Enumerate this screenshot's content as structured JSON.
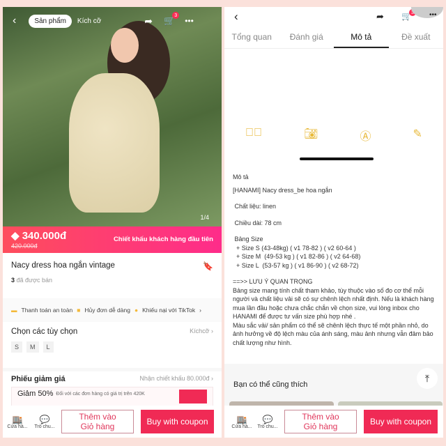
{
  "left": {
    "nav": {
      "pill": "Sản phẩm",
      "tab2": "Kích cỡ",
      "cart_count": "3"
    },
    "image_counter": "1/4",
    "price": {
      "current": "340.000đ",
      "original": "420.000đ",
      "promo": "Chiết khấu khách hàng đầu tiên"
    },
    "product": {
      "title": "Nacy dress hoa ngắn vintage",
      "sold_count": "3",
      "sold_label": "đã được bán"
    },
    "guarantees": [
      "Thanh toán an toàn",
      "Hủy đơn dễ dàng",
      "Khiếu nại với TikTok"
    ],
    "options": {
      "title": "Chọn các tùy chọn",
      "link": "Kíchcỡ",
      "sizes": [
        "S",
        "M",
        "L"
      ]
    },
    "coupons": {
      "title": "Phiếu giảm giá",
      "link": "Nhận chiết khấu 80.000đ",
      "coupon_title": "Giảm 50%",
      "coupon_desc": "Đối với các đơn hàng có giá trị trên 420K"
    }
  },
  "right": {
    "cart_count": "3",
    "tabs": [
      "Tổng quan",
      "Đánh giá",
      "Mô tả",
      "Đề xuất"
    ],
    "active_tab": "Mô tả",
    "description": {
      "heading": "Mô tả",
      "lines": [
        "[HANAMI] Nacy dress_be hoa ngắn",
        " Chất liệu: linen",
        " Chiều dài: 78 cm"
      ],
      "size_title": " Bảng Size",
      "sizes": [
        "  + Size S (43-48kg) ( v1 78-82 ) ( v2 60-64 )",
        "  + Size M  (49-53 kg ) ( v1 82-86 ) ( v2 64-68)",
        "  + Size L  (53-57 kg ) ( v1 86-90 ) ( v2 68-72)"
      ],
      "note_title": "==>> LƯU Ý QUAN TRỌNG",
      "note1": " Bảng size mang tính chất tham khảo, tùy thuộc vào số đo cơ thể mỗi người và chất liệu vải sẽ có sự chênh lệch nhất định. Nếu là khách hàng mua lần đầu hoặc chưa chắc chắn về chọn size, vui lòng inbox cho HANAMI để được tư vấn size phù hợp nhé .",
      "note2": " Màu sắc vải/ sản phẩm có thể sẽ chênh lệch thực tế một phần nhỏ, do ảnh hưởng về độ lệch màu của ánh sáng, màu ảnh nhưng vẫn đảm bảo chất lượng như hình."
    },
    "recommend_title": "Bạn có thể cũng thích"
  },
  "bottom": {
    "shop": "Cửa hà...",
    "chat": "Trò chu...",
    "add_cart_line1": "Thêm vào",
    "add_cart_line2": "Giỏ hàng",
    "buy": "Buy with coupon"
  },
  "colors": {
    "accent": "#fe2c55",
    "icon_yellow": "#e8b93a",
    "background": "#fbe1db"
  }
}
